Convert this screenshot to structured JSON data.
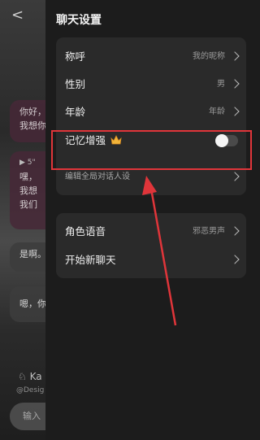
{
  "background_chat": {
    "back_glyph": "<",
    "messages": [
      {
        "lines": [
          "你好，",
          "我想你"
        ]
      },
      {
        "voice_label": "5\"",
        "lines": [
          "嘿，",
          "我想",
          "我们"
        ]
      },
      {
        "lines": [
          "是啊。"
        ]
      },
      {
        "lines": [
          "嗯，你"
        ]
      }
    ],
    "character_name": "Ka",
    "character_handle": "@Desig",
    "input_placeholder": "输入"
  },
  "settings_panel": {
    "title": "聊天设置",
    "group1": [
      {
        "label": "称呼",
        "value": "我的昵称",
        "type": "link"
      },
      {
        "label": "性别",
        "value": "男",
        "type": "link"
      },
      {
        "label": "年龄",
        "value": "年龄",
        "type": "link"
      },
      {
        "label": "记忆增强",
        "type": "toggle",
        "toggle_on": false,
        "badge_icon": "crown-icon"
      },
      {
        "label": "编辑全局对话人设",
        "type": "link"
      }
    ],
    "group2": [
      {
        "label": "角色语音",
        "value": "邪恶男声",
        "type": "link"
      },
      {
        "label": "开始新聊天",
        "type": "link"
      }
    ]
  },
  "annotation": {
    "color": "#e0353a",
    "shapes": [
      "highlight-rectangle",
      "arrow"
    ]
  }
}
